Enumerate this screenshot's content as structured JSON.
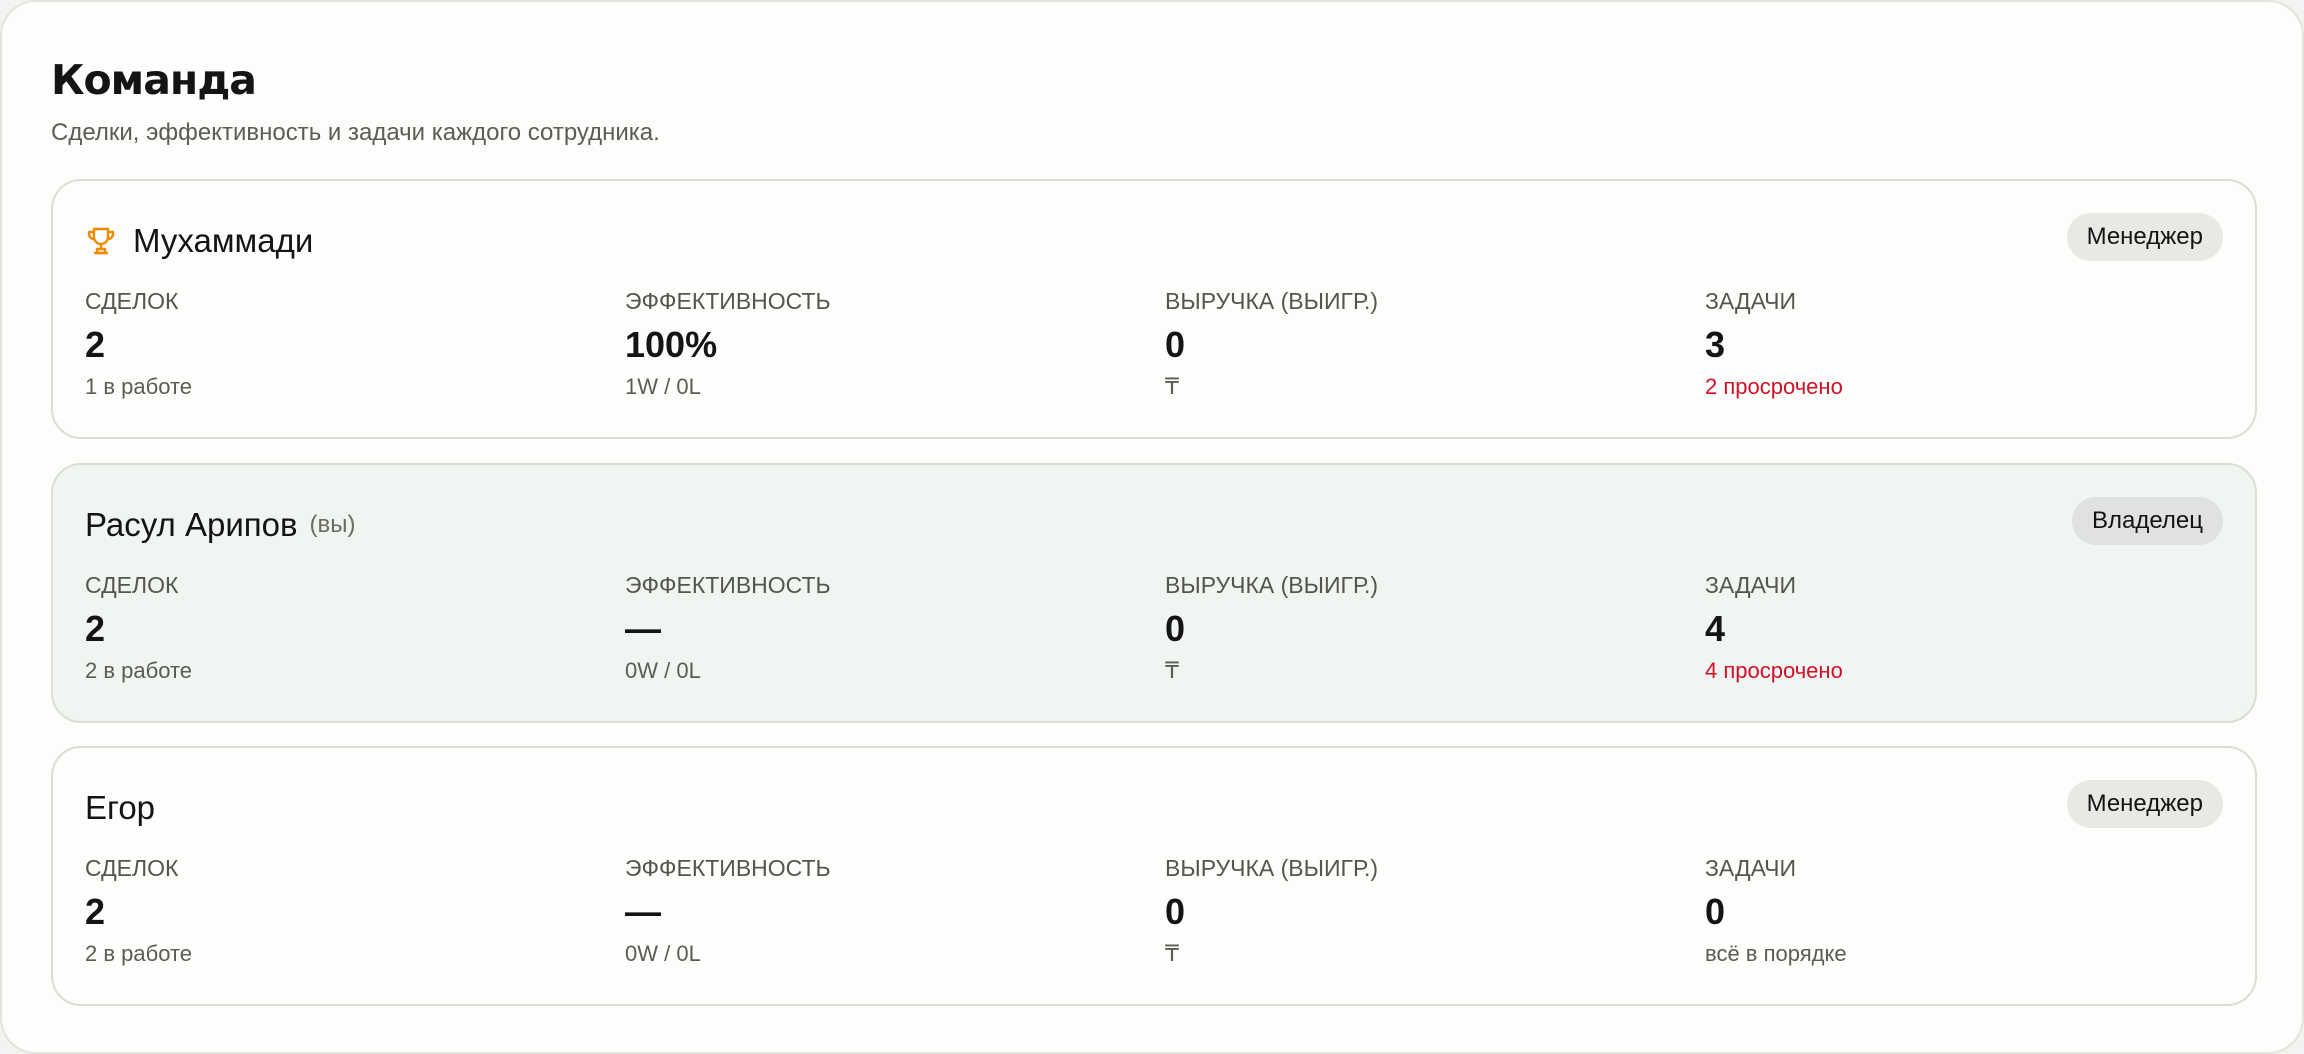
{
  "page": {
    "title": "Команда",
    "subtitle": "Сделки, эффективность и задачи каждого сотрудника."
  },
  "stat_labels": {
    "deals": "СДЕЛОК",
    "efficiency": "ЭФФЕКТИВНОСТЬ",
    "revenue": "ВЫРУЧКА (ВЫИГР.)",
    "tasks": "ЗАДАЧИ"
  },
  "colors": {
    "alert": "#d0102a",
    "trophy": "#f08a00",
    "self_card_bg": "#f1f5f1"
  },
  "members": [
    {
      "name": "Мухаммади",
      "icon": "trophy-icon",
      "role": "Менеджер",
      "deals": "2",
      "deals_sub": "1 в работе",
      "efficiency": "100%",
      "efficiency_sub": "1W / 0L",
      "revenue": "0",
      "revenue_sub": "₸",
      "tasks": "3",
      "tasks_sub": "2 просрочено"
    },
    {
      "name": "Расул Арипов",
      "you_tag": "(вы)",
      "role": "Владелец",
      "deals": "2",
      "deals_sub": "2 в работе",
      "efficiency": "—",
      "efficiency_sub": "0W / 0L",
      "revenue": "0",
      "revenue_sub": "₸",
      "tasks": "4",
      "tasks_sub": "4 просрочено"
    },
    {
      "name": "Егор",
      "role": "Менеджер",
      "deals": "2",
      "deals_sub": "2 в работе",
      "efficiency": "—",
      "efficiency_sub": "0W / 0L",
      "revenue": "0",
      "revenue_sub": "₸",
      "tasks": "0",
      "tasks_sub": "всё в порядке"
    }
  ]
}
